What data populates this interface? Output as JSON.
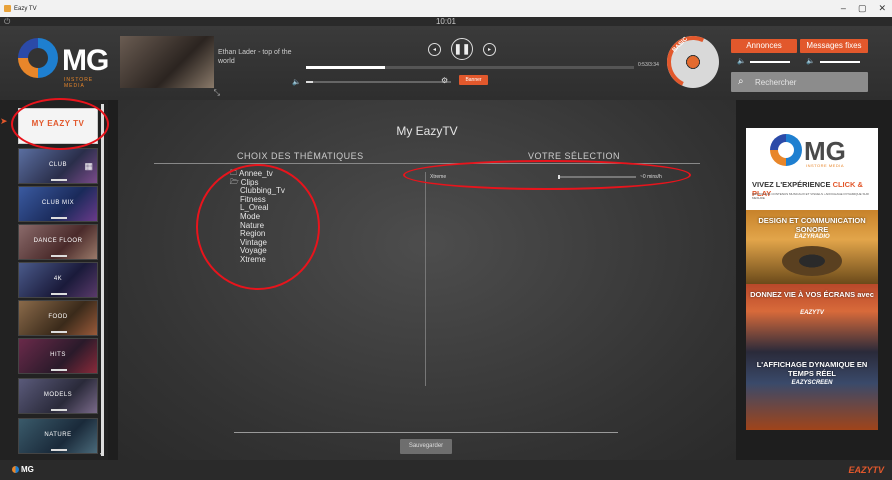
{
  "window": {
    "title": "Eazy TV",
    "buttons": [
      "–",
      "▢",
      "✕"
    ]
  },
  "clock": "10:01",
  "header": {
    "logo_text": "MG",
    "logo_sub": "INSTORE MEDIA",
    "now_playing": "Ethan Lader - top of the world",
    "time": "0:53/3:34",
    "progress_fraction": 0.24,
    "banner_label": "Banner",
    "vinyl_badge": "BASIC",
    "annonces_label": "Annonces",
    "messages_label": "Messages fixes",
    "search_placeholder": "Rechercher"
  },
  "sidebar": {
    "items": [
      {
        "label": "MY EAZY TV",
        "name": "sidebar-item-my-eazytv"
      },
      {
        "label": "CLUB",
        "name": "sidebar-item-club"
      },
      {
        "label": "CLUB MIX",
        "name": "sidebar-item-club-mix"
      },
      {
        "label": "DANCE FLOOR",
        "name": "sidebar-item-dance-floor"
      },
      {
        "label": "4K",
        "name": "sidebar-item-4k"
      },
      {
        "label": "FOOD",
        "name": "sidebar-item-food"
      },
      {
        "label": "HITS",
        "name": "sidebar-item-hits"
      },
      {
        "label": "MODELS",
        "name": "sidebar-item-models"
      },
      {
        "label": "NATURE",
        "name": "sidebar-item-nature"
      }
    ]
  },
  "main": {
    "title": "My EazyTV",
    "left_heading": "CHOIX DES THÉMATIQUES",
    "right_heading": "VOTRE SÉLECTION",
    "tree": {
      "folders": [
        "Annee_tv",
        "Clips"
      ],
      "children": [
        "Clubbing_Tv",
        "Fitness",
        "L_Oreal",
        "Mode",
        "Nature",
        "Region",
        "Vintage",
        "Voyage",
        "Xtreme"
      ]
    },
    "selection": [
      {
        "name": "Xtreme",
        "value": "~0 mins/h"
      }
    ],
    "save_label": "Sauvegarder"
  },
  "ad": {
    "logo_text": "MG",
    "logo_sub": "INSTORE MEDIA",
    "tagline_1": "VIVEZ L'EXPÉRIENCE",
    "tagline_1_highlight": "CLICK & PLAY",
    "tagline_1_sub": "GESTION DE CONTENUS MUSICAUX ET VISUELS • AFFICHAGE DYNAMIQUE SUR MESURE",
    "panel_1_text": "DESIGN ET COMMUNICATION SONORE",
    "panel_1_brand": "EAZYRADIO",
    "panel_2_text": "DONNEZ VIE À VOS ÉCRANS avec",
    "panel_2_brand": "EAZYTV",
    "panel_3_text": "L'AFFICHAGE DYNAMIQUE EN TEMPS RÉEL",
    "panel_3_brand": "EAZYSCREEN"
  },
  "footer": {
    "logo_text": "MG",
    "brand": "EAZYTV"
  },
  "colors": {
    "accent": "#e2582c",
    "annotation": "#e8141c"
  }
}
